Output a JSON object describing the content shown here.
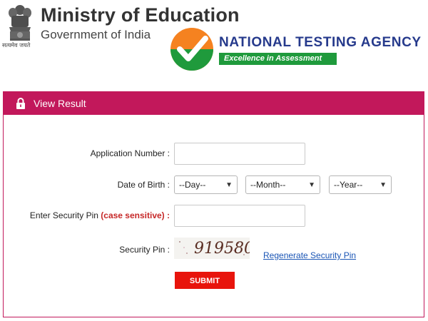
{
  "header": {
    "emblem_motto": "सत्यमेव जयते",
    "ministry_title": "Ministry of Education",
    "ministry_subtitle": "Government of India",
    "nta_name": "NATIONAL TESTING AGENCY",
    "nta_tagline": "Excellence in Assessment"
  },
  "panel": {
    "title": "View Result",
    "accent_color": "#c2185b"
  },
  "form": {
    "application_number_label": "Application Number :",
    "application_number_value": "",
    "dob_label": "Date of Birth :",
    "dob_day": "--Day--",
    "dob_month": "--Month--",
    "dob_year": "--Year--",
    "security_pin_entry_label": "Enter Security Pin",
    "security_pin_entry_label_note": "(case sensitive) :",
    "security_pin_value": "",
    "security_pin_label": "Security Pin :",
    "captcha_text": "919580",
    "regenerate_link": "Regenerate Security Pin",
    "submit_label": "SUBMIT"
  }
}
